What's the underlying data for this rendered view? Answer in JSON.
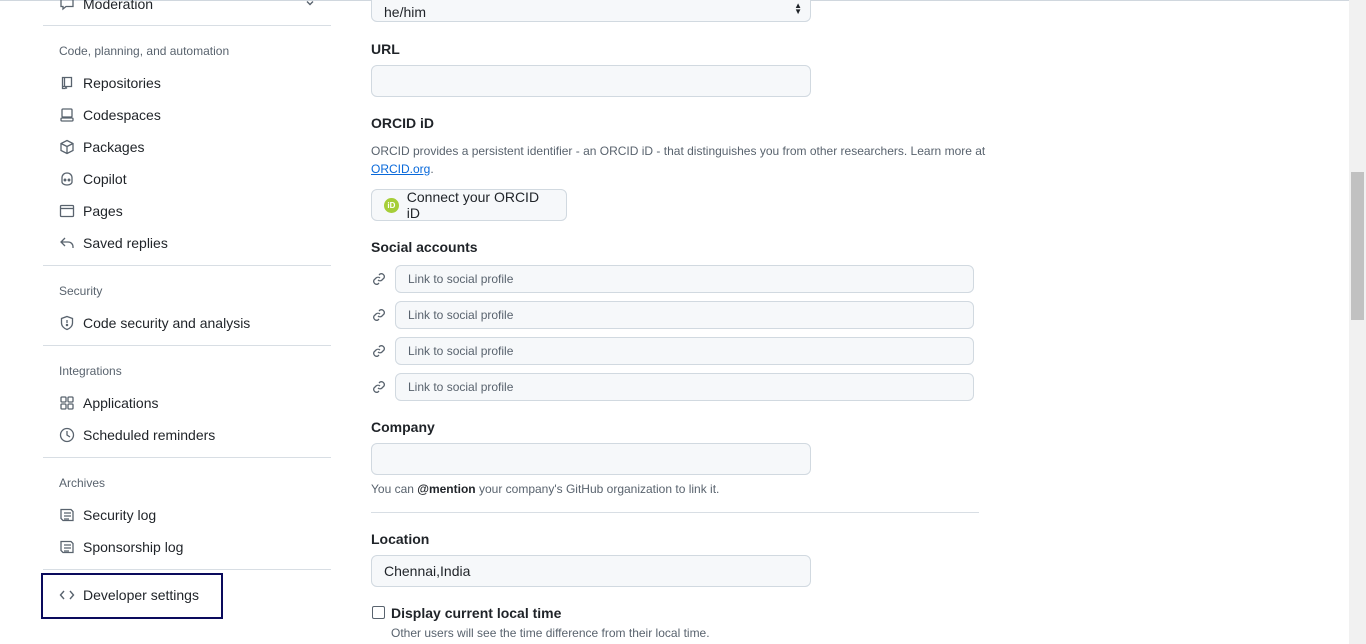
{
  "sidebar": {
    "moderation": "Moderation",
    "sections": {
      "code": "Code, planning, and automation",
      "security": "Security",
      "integrations": "Integrations",
      "archives": "Archives"
    },
    "items": {
      "repositories": "Repositories",
      "codespaces": "Codespaces",
      "packages": "Packages",
      "copilot": "Copilot",
      "pages": "Pages",
      "saved_replies": "Saved replies",
      "code_security": "Code security and analysis",
      "applications": "Applications",
      "scheduled_reminders": "Scheduled reminders",
      "security_log": "Security log",
      "sponsorship_log": "Sponsorship log",
      "developer_settings": "Developer settings"
    }
  },
  "form": {
    "pronouns_value": "he/him",
    "url_label": "URL",
    "url_value": "",
    "orcid_label": "ORCID iD",
    "orcid_desc": "ORCID provides a persistent identifier - an ORCID iD - that distinguishes you from other researchers. Learn more at",
    "orcid_link": "ORCID.org",
    "orcid_period": ".",
    "orcid_button": "Connect your ORCID iD",
    "orcid_logo": "iD",
    "social_label": "Social accounts",
    "social_placeholder": "Link to social profile",
    "company_label": "Company",
    "company_value": "",
    "company_note_pre": "You can ",
    "company_note_mention": "@mention",
    "company_note_post": " your company's GitHub organization to link it.",
    "location_label": "Location",
    "location_value": "Chennai,India",
    "display_time_label": "Display current local time",
    "display_time_note": "Other users will see the time difference from their local time."
  },
  "colors": {
    "focus_outline": "#0a0a5c",
    "link": "#0969da",
    "orcid_green": "#a6ce39"
  }
}
